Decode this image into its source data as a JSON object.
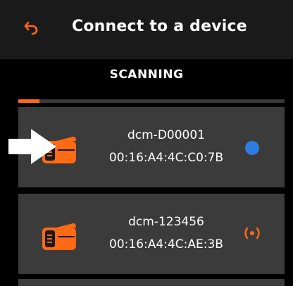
{
  "header": {
    "title": "Connect to a device",
    "back_icon": "back-arrow-icon"
  },
  "scan": {
    "label": "SCANNING",
    "progress_fraction": 0.08
  },
  "colors": {
    "accent": "#ff6a13",
    "connected": "#2f7de1",
    "card": "#3b3b3b"
  },
  "devices": [
    {
      "name": "dcm-D00001",
      "mac": "00:16:A4:4C:C0:7B",
      "status": "connected",
      "icon": "device-printer-icon"
    },
    {
      "name": "dcm-123456",
      "mac": "00:16:A4:4C:AE:3B",
      "status": "broadcasting",
      "icon": "device-printer-icon"
    }
  ]
}
